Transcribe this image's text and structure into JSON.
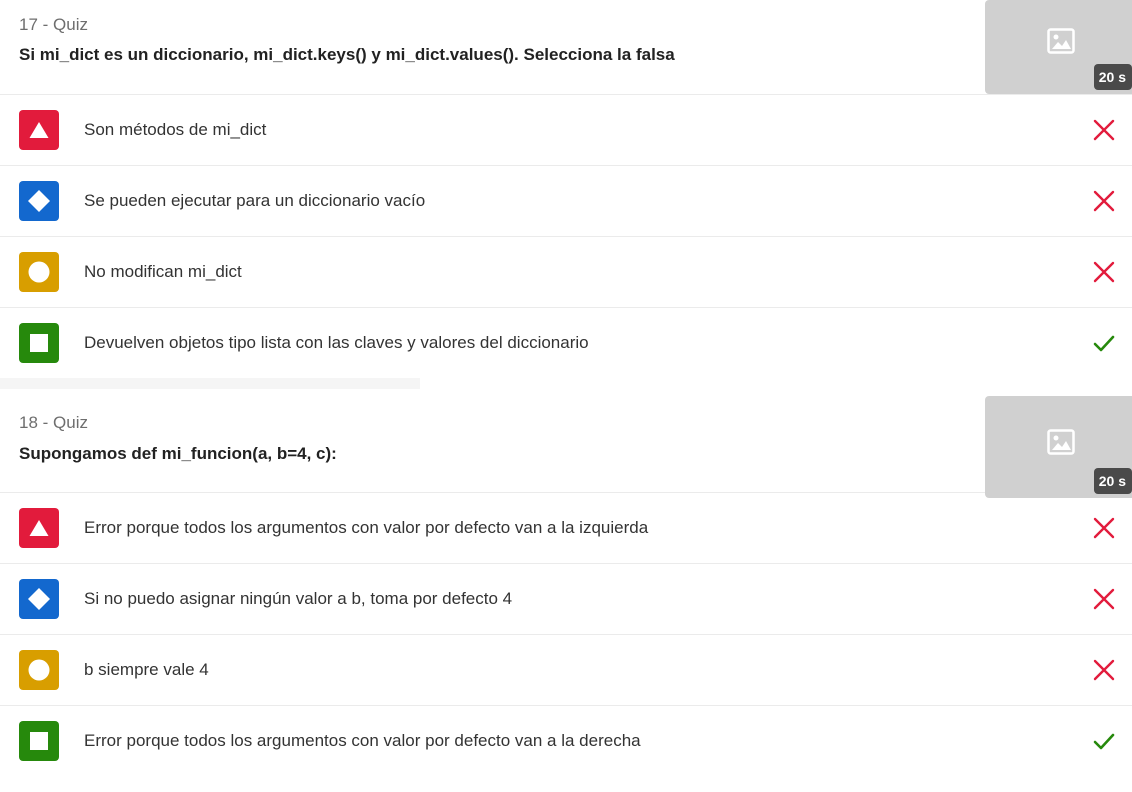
{
  "questions": [
    {
      "number_label": "17 - Quiz",
      "title": "Si mi_dict es un diccionario, mi_dict.keys() y mi_dict.values(). Selecciona la falsa",
      "timer": "20 s",
      "answers": [
        {
          "shape": "triangle-icon",
          "color": "#e21b3c",
          "text": "Son métodos de mi_dict",
          "correct": false
        },
        {
          "shape": "diamond-icon",
          "color": "#1368ce",
          "text": "Se pueden ejecutar para un diccionario vacío",
          "correct": false
        },
        {
          "shape": "circle-icon",
          "color": "#d89e00",
          "text": "No modifican mi_dict",
          "correct": false
        },
        {
          "shape": "square-icon",
          "color": "#26890c",
          "text": "Devuelven objetos tipo lista con las claves y valores del diccionario",
          "correct": true
        }
      ]
    },
    {
      "number_label": "18 - Quiz",
      "title": "Supongamos def mi_funcion(a, b=4, c):",
      "timer": "20 s",
      "answers": [
        {
          "shape": "triangle-icon",
          "color": "#e21b3c",
          "text": "Error porque todos los argumentos con valor por defecto van a la izquierda",
          "correct": false
        },
        {
          "shape": "diamond-icon",
          "color": "#1368ce",
          "text": "Si no puedo asignar ningún valor a b, toma por defecto 4",
          "correct": false
        },
        {
          "shape": "circle-icon",
          "color": "#d89e00",
          "text": "b siempre vale 4",
          "correct": false
        },
        {
          "shape": "square-icon",
          "color": "#26890c",
          "text": "Error porque todos los argumentos con valor por defecto van a la derecha",
          "correct": true
        }
      ]
    }
  ],
  "colors": {
    "wrong": "#e21b3c",
    "correct": "#26890c"
  }
}
